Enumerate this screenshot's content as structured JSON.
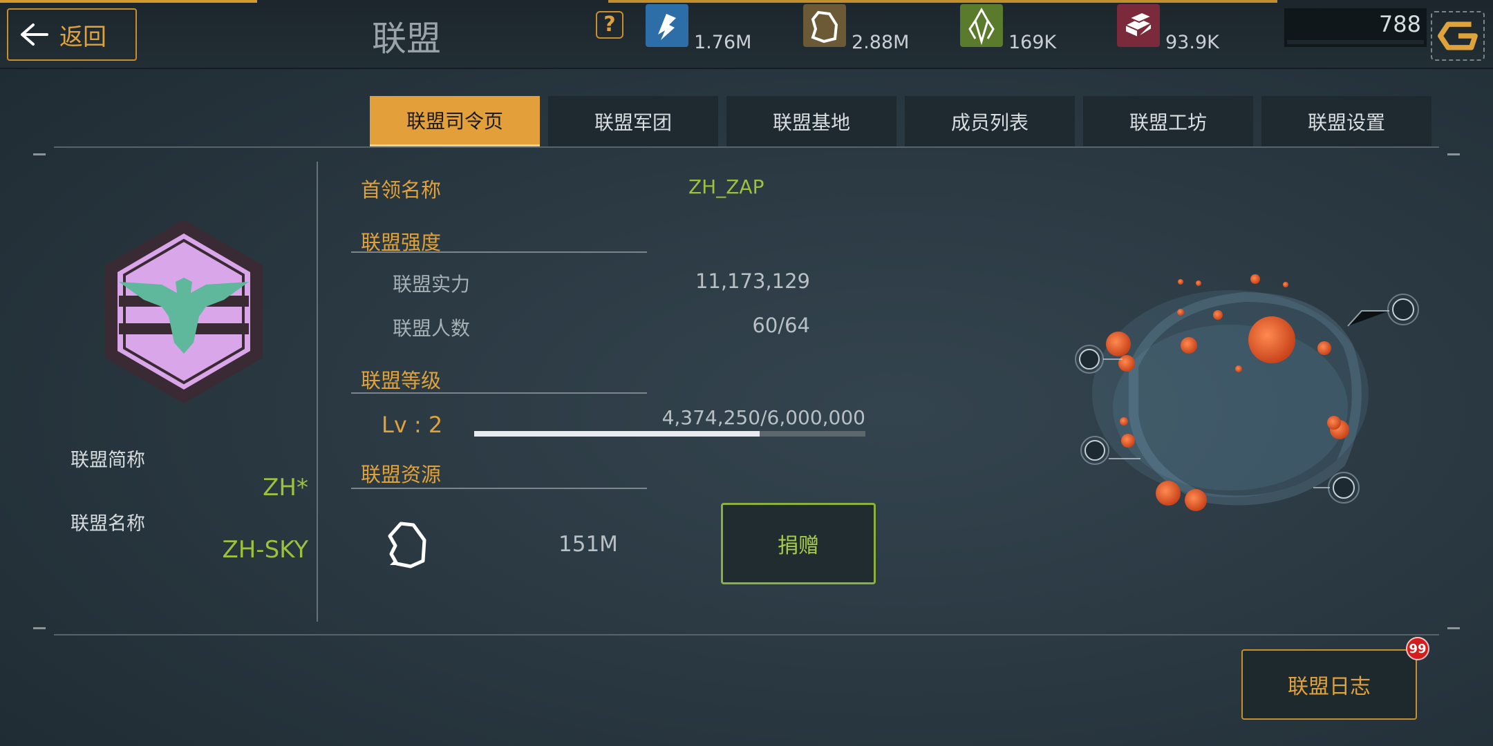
{
  "header": {
    "back_label": "返回",
    "title": "联盟",
    "help_icon": "?",
    "resources": [
      {
        "name": "energy-icon",
        "value": "1.76M",
        "color": "#2d6ea8"
      },
      {
        "name": "ore-icon",
        "value": "2.88M",
        "color": "#6b5a35"
      },
      {
        "name": "crystal-icon",
        "value": "169K",
        "color": "#5a7a2c"
      },
      {
        "name": "metal-icon",
        "value": "93.9K",
        "color": "#7a2a3a"
      }
    ],
    "gems": "788"
  },
  "tabs": [
    {
      "label": "联盟司令页",
      "active": true
    },
    {
      "label": "联盟军团",
      "active": false
    },
    {
      "label": "联盟基地",
      "active": false
    },
    {
      "label": "成员列表",
      "active": false
    },
    {
      "label": "联盟工坊",
      "active": false
    },
    {
      "label": "联盟设置",
      "active": false
    }
  ],
  "alliance": {
    "short_label": "联盟简称",
    "short_value": "ZH*",
    "name_label": "联盟名称",
    "name_value": "ZH-SKY"
  },
  "info": {
    "leader_label": "首领名称",
    "leader_value": "ZH_ZAP",
    "strength_title": "联盟强度",
    "power_label": "联盟实力",
    "power_value": "11,173,129",
    "members_label": "联盟人数",
    "members_value": "60/64",
    "level_title": "联盟等级",
    "level_label": "Lv : 2",
    "xp_text": "4,374,250/6,000,000",
    "xp_fraction": 0.729,
    "resources_title": "联盟资源",
    "ore_amount": "151M",
    "donate_label": "捐赠"
  },
  "footer": {
    "log_label": "联盟日志",
    "log_badge": "99"
  },
  "colors": {
    "accent": "#e0a23a",
    "green": "#9cc13f"
  }
}
